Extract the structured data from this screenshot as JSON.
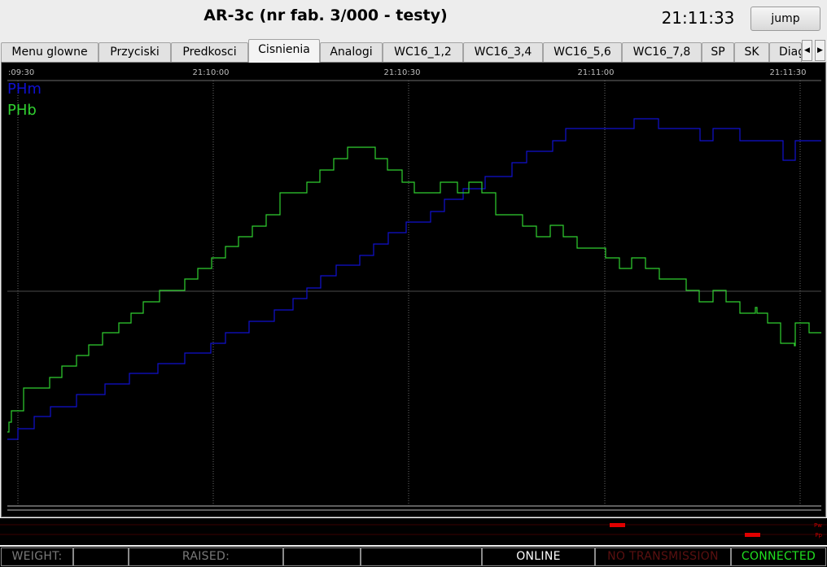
{
  "header": {
    "title": "AR-3c (nr fab. 3/000 - testy)",
    "clock": "21:11:33",
    "jump_label": "jump"
  },
  "tabs": [
    {
      "label": "Menu glowne"
    },
    {
      "label": "Przyciski"
    },
    {
      "label": "Predkosci"
    },
    {
      "label": "Cisnienia",
      "active": true
    },
    {
      "label": "Analogi"
    },
    {
      "label": "WC16_1,2"
    },
    {
      "label": "WC16_3,4"
    },
    {
      "label": "WC16_5,6"
    },
    {
      "label": "WC16_7,8"
    },
    {
      "label": "SP"
    },
    {
      "label": "SK"
    },
    {
      "label": "Diag"
    }
  ],
  "chart_data": {
    "type": "line",
    "x_tick_labels": [
      ":09:30",
      "21:10:00",
      "21:10:30",
      "21:11:00",
      "21:11:30"
    ],
    "series": [
      {
        "name": "PHm",
        "color": "#1010d0",
        "x": [
          0,
          13,
          13,
          33,
          33,
          53,
          53,
          85,
          85,
          120,
          120,
          150,
          150,
          185,
          185,
          218,
          218,
          250,
          250,
          268,
          268,
          297,
          297,
          328,
          328,
          351,
          351,
          368,
          368,
          385,
          385,
          404,
          404,
          433,
          433,
          450,
          450,
          468,
          468,
          490,
          490,
          520,
          520,
          537,
          537,
          560,
          560,
          587,
          587,
          620,
          620,
          638,
          638,
          670,
          670,
          686,
          686,
          770,
          770,
          800,
          800,
          851,
          851,
          867,
          867,
          900,
          900,
          953,
          953,
          968,
          968,
          1000
        ],
        "y": [
          440,
          440,
          427,
          427,
          412,
          412,
          400,
          400,
          385,
          385,
          372,
          372,
          359,
          359,
          347,
          347,
          334,
          334,
          322,
          322,
          309,
          309,
          295,
          295,
          281,
          281,
          267,
          267,
          254,
          254,
          239,
          239,
          226,
          226,
          214,
          214,
          200,
          200,
          186,
          186,
          173,
          173,
          160,
          160,
          145,
          145,
          132,
          132,
          117,
          117,
          100,
          100,
          86,
          86,
          73,
          73,
          58,
          58,
          46,
          46,
          58,
          58,
          73,
          73,
          58,
          58,
          73,
          73,
          97,
          97,
          73,
          73
        ]
      },
      {
        "name": "PHb",
        "color": "#30d030",
        "x": [
          0,
          2,
          2,
          5,
          5,
          20,
          20,
          52,
          52,
          67,
          67,
          85,
          85,
          100,
          100,
          117,
          117,
          137,
          137,
          152,
          152,
          167,
          167,
          187,
          187,
          218,
          218,
          234,
          234,
          251,
          251,
          268,
          268,
          284,
          284,
          301,
          301,
          318,
          318,
          335,
          335,
          368,
          368,
          384,
          384,
          401,
          401,
          418,
          418,
          452,
          452,
          467,
          467,
          485,
          485,
          500,
          500,
          532,
          532,
          553,
          553,
          567,
          567,
          583,
          583,
          600,
          600,
          633,
          633,
          650,
          650,
          667,
          667,
          683,
          683,
          700,
          700,
          735,
          735,
          752,
          752,
          767,
          767,
          784,
          784,
          801,
          801,
          834,
          834,
          850,
          850,
          867,
          867,
          883,
          883,
          900,
          900,
          919,
          919,
          921,
          921,
          934,
          934,
          950,
          950,
          967,
          967,
          968,
          968,
          985,
          985,
          1000
        ],
        "y": [
          431,
          431,
          419,
          419,
          405,
          405,
          377,
          377,
          364,
          364,
          350,
          350,
          337,
          337,
          324,
          324,
          309,
          309,
          297,
          297,
          285,
          285,
          271,
          271,
          257,
          257,
          243,
          243,
          230,
          230,
          217,
          217,
          203,
          203,
          191,
          191,
          178,
          178,
          164,
          164,
          137,
          137,
          124,
          124,
          109,
          109,
          95,
          95,
          81,
          81,
          95,
          95,
          109,
          109,
          124,
          124,
          137,
          137,
          124,
          124,
          137,
          137,
          124,
          124,
          137,
          137,
          164,
          164,
          178,
          178,
          191,
          191,
          177,
          177,
          191,
          191,
          205,
          205,
          217,
          217,
          230,
          230,
          217,
          217,
          230,
          230,
          243,
          243,
          257,
          257,
          271,
          271,
          257,
          257,
          271,
          271,
          285,
          285,
          278,
          278,
          285,
          285,
          297,
          297,
          322,
          322,
          325,
          325,
          297,
          297,
          309,
          309
        ]
      }
    ],
    "grid": true,
    "legend_placement": "top-left"
  },
  "status_strip": {
    "labels": [
      "Pw",
      "Pp"
    ],
    "marker_color": "#e00000"
  },
  "footer": {
    "weight_label": "WEIGHT:",
    "weight_value": "",
    "raised_label": "RAISED:",
    "raised_value": "",
    "online_label": "ONLINE",
    "transmission_label": "NO TRANSMISSION",
    "connection_label": "CONNECTED",
    "colors": {
      "online": "#ffffff",
      "transmission": "#5a1010",
      "connection": "#20e020",
      "label": "#7a7a7a"
    }
  }
}
